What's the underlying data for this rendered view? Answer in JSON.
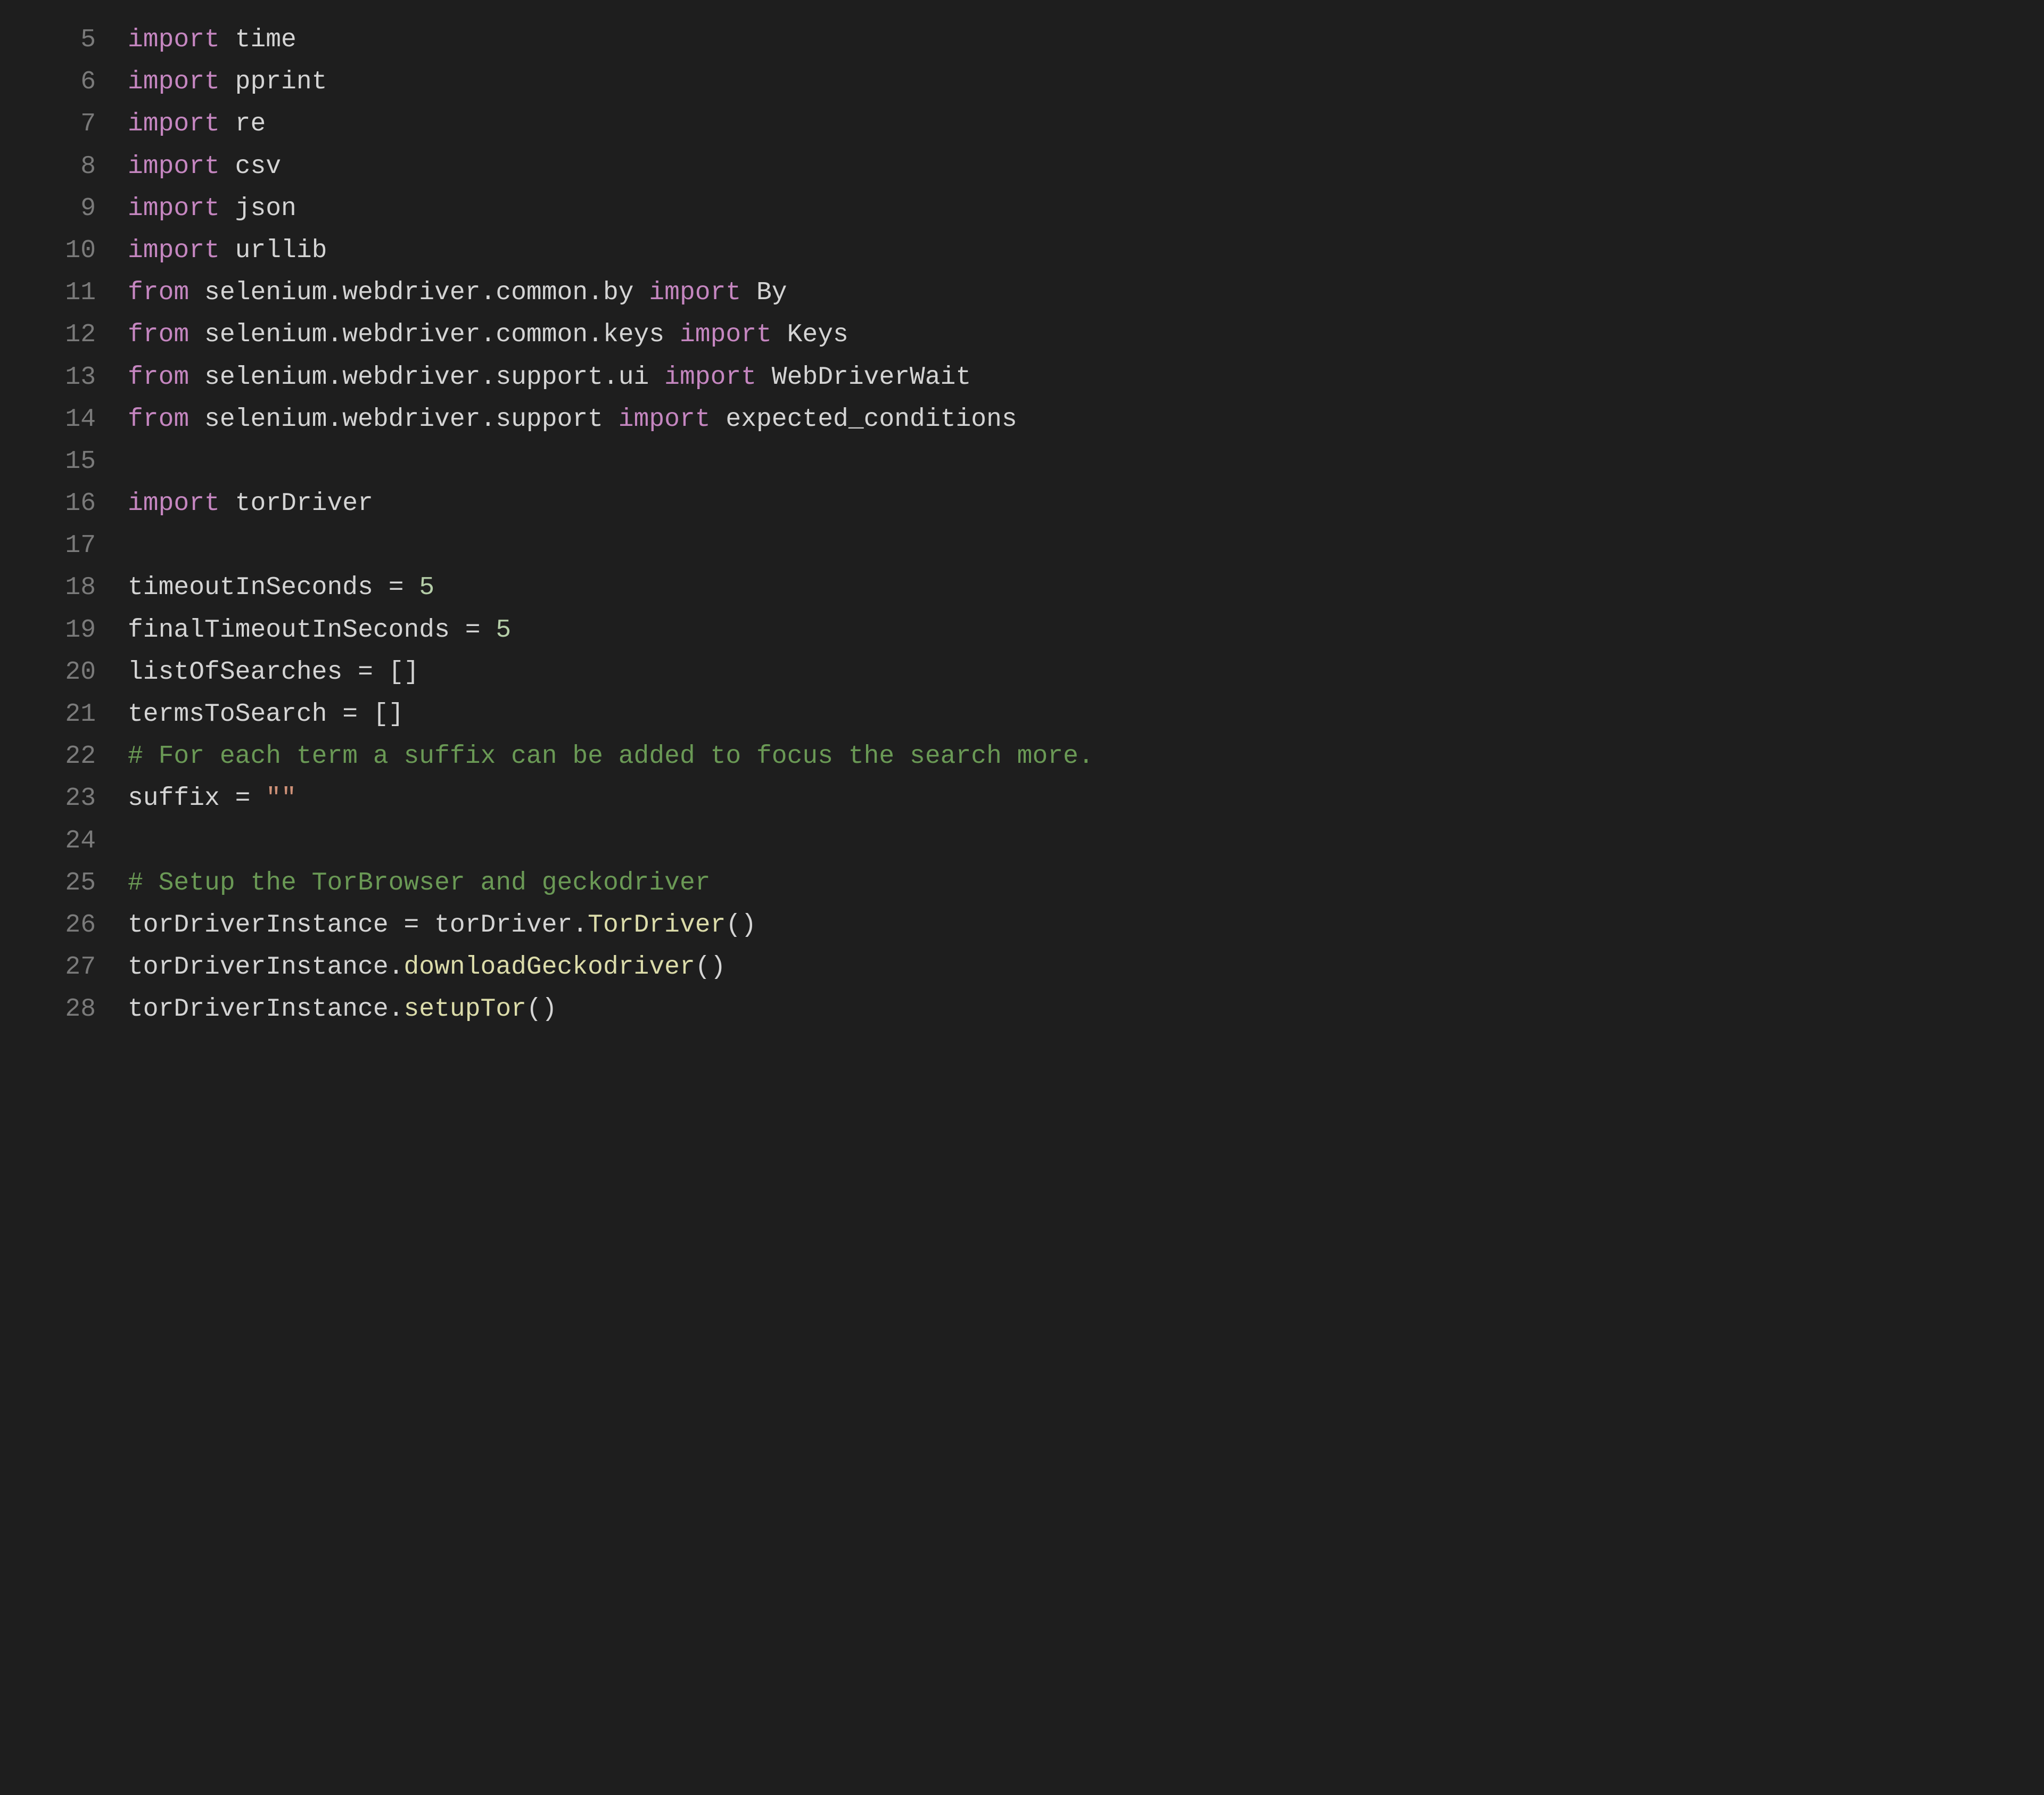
{
  "editor": {
    "language": "python",
    "lines": [
      {
        "num": 5,
        "tokens": [
          {
            "t": "import",
            "c": "kw"
          },
          {
            "t": " time",
            "c": "id"
          }
        ]
      },
      {
        "num": 6,
        "tokens": [
          {
            "t": "import",
            "c": "kw"
          },
          {
            "t": " pprint",
            "c": "id"
          }
        ]
      },
      {
        "num": 7,
        "tokens": [
          {
            "t": "import",
            "c": "kw"
          },
          {
            "t": " re",
            "c": "id"
          }
        ]
      },
      {
        "num": 8,
        "tokens": [
          {
            "t": "import",
            "c": "kw"
          },
          {
            "t": " csv",
            "c": "id"
          }
        ]
      },
      {
        "num": 9,
        "tokens": [
          {
            "t": "import",
            "c": "kw"
          },
          {
            "t": " json",
            "c": "id"
          }
        ]
      },
      {
        "num": 10,
        "tokens": [
          {
            "t": "import",
            "c": "kw"
          },
          {
            "t": " urllib",
            "c": "id"
          }
        ]
      },
      {
        "num": 11,
        "tokens": [
          {
            "t": "from",
            "c": "kw"
          },
          {
            "t": " selenium.webdriver.common.by ",
            "c": "id"
          },
          {
            "t": "import",
            "c": "kw"
          },
          {
            "t": " By",
            "c": "id"
          }
        ]
      },
      {
        "num": 12,
        "tokens": [
          {
            "t": "from",
            "c": "kw"
          },
          {
            "t": " selenium.webdriver.common.keys ",
            "c": "id"
          },
          {
            "t": "import",
            "c": "kw"
          },
          {
            "t": " Keys",
            "c": "id"
          }
        ]
      },
      {
        "num": 13,
        "tokens": [
          {
            "t": "from",
            "c": "kw"
          },
          {
            "t": " selenium.webdriver.support.ui ",
            "c": "id"
          },
          {
            "t": "import",
            "c": "kw"
          },
          {
            "t": " WebDriverWait",
            "c": "id"
          }
        ]
      },
      {
        "num": 14,
        "tokens": [
          {
            "t": "from",
            "c": "kw"
          },
          {
            "t": " selenium.webdriver.support ",
            "c": "id"
          },
          {
            "t": "import",
            "c": "kw"
          },
          {
            "t": " expected_conditions",
            "c": "id"
          }
        ]
      },
      {
        "num": 15,
        "tokens": []
      },
      {
        "num": 16,
        "tokens": [
          {
            "t": "import",
            "c": "kw"
          },
          {
            "t": " torDriver",
            "c": "id"
          }
        ]
      },
      {
        "num": 17,
        "tokens": []
      },
      {
        "num": 18,
        "tokens": [
          {
            "t": "timeoutInSeconds ",
            "c": "id"
          },
          {
            "t": "=",
            "c": "op"
          },
          {
            "t": " ",
            "c": "id"
          },
          {
            "t": "5",
            "c": "num"
          }
        ]
      },
      {
        "num": 19,
        "tokens": [
          {
            "t": "finalTimeoutInSeconds ",
            "c": "id"
          },
          {
            "t": "=",
            "c": "op"
          },
          {
            "t": " ",
            "c": "id"
          },
          {
            "t": "5",
            "c": "num"
          }
        ]
      },
      {
        "num": 20,
        "tokens": [
          {
            "t": "listOfSearches ",
            "c": "id"
          },
          {
            "t": "=",
            "c": "op"
          },
          {
            "t": " []",
            "c": "id"
          }
        ]
      },
      {
        "num": 21,
        "tokens": [
          {
            "t": "termsToSearch ",
            "c": "id"
          },
          {
            "t": "=",
            "c": "op"
          },
          {
            "t": " []",
            "c": "id"
          }
        ]
      },
      {
        "num": 22,
        "tokens": [
          {
            "t": "# For each term a suffix can be added to focus the search more.",
            "c": "com"
          }
        ]
      },
      {
        "num": 23,
        "tokens": [
          {
            "t": "suffix ",
            "c": "id"
          },
          {
            "t": "=",
            "c": "op"
          },
          {
            "t": " ",
            "c": "id"
          },
          {
            "t": "\"\"",
            "c": "str"
          }
        ]
      },
      {
        "num": 24,
        "tokens": []
      },
      {
        "num": 25,
        "tokens": [
          {
            "t": "# Setup the TorBrowser and geckodriver",
            "c": "com"
          }
        ]
      },
      {
        "num": 26,
        "tokens": [
          {
            "t": "torDriverInstance ",
            "c": "id"
          },
          {
            "t": "=",
            "c": "op"
          },
          {
            "t": " torDriver.",
            "c": "id"
          },
          {
            "t": "TorDriver",
            "c": "fn"
          },
          {
            "t": "()",
            "c": "id"
          }
        ]
      },
      {
        "num": 27,
        "tokens": [
          {
            "t": "torDriverInstance.",
            "c": "id"
          },
          {
            "t": "downloadGeckodriver",
            "c": "fn"
          },
          {
            "t": "()",
            "c": "id"
          }
        ]
      },
      {
        "num": 28,
        "tokens": [
          {
            "t": "torDriverInstance.",
            "c": "id"
          },
          {
            "t": "setupTor",
            "c": "fn"
          },
          {
            "t": "()",
            "c": "id"
          }
        ]
      }
    ]
  }
}
